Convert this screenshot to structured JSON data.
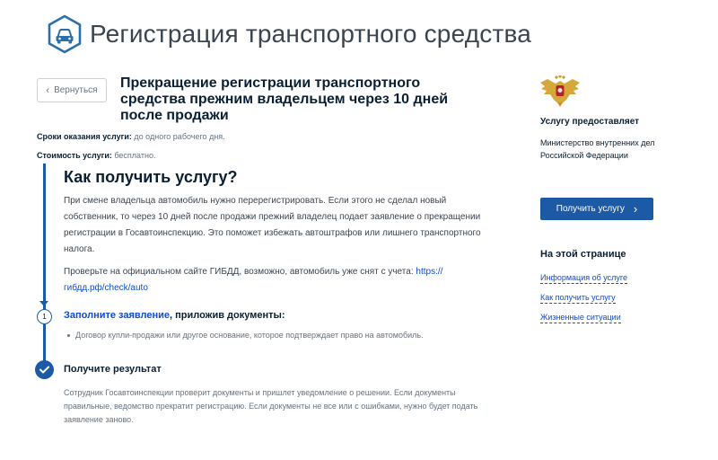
{
  "header": {
    "title": "Регистрация транспортного средства",
    "icon": "car-icon"
  },
  "back_button": {
    "label": "Вернуться",
    "icon": "chevron-left-icon"
  },
  "service": {
    "title": "Прекращение регистрации транспортного средства прежним владельцем через 10 дней после продажи"
  },
  "meta": {
    "term_label": "Сроки оказания услуги:",
    "term_value": "до одного рабочего дня.",
    "cost_label": "Стоимость услуги:",
    "cost_value": "бесплатно."
  },
  "how_to": {
    "heading": "Как получить услугу?",
    "intro": "При смене владельца автомобиль нужно перерегистрировать. Если этого не сделал новый собственник, то через 10 дней после продажи прежний владелец подает заявление о прекращении регистрации в Госавтоинспекцию. Это поможет избежать автоштрафов или лишнего транспортного налога.",
    "check_text": "Проверьте на официальном сайте ГИБДД, возможно, автомобиль уже снят с учета:",
    "check_link": "https:// гибдд.рф/check/auto"
  },
  "step1": {
    "number": "1",
    "link_text": "Заполните заявление",
    "rest_text": ", приложив документы:",
    "items": [
      "Договор купли-продажи или другое основание, которое подтверждает право на автомобиль."
    ]
  },
  "result": {
    "heading": "Получите результат",
    "text": "Сотрудник Госавтоинспекции проверит документы и пришлет уведомление о решении. Если документы правильные, ведомство прекратит регистрацию. Если документы не все или с ошибками, нужно будет подать заявление заново.",
    "icon": "check-icon"
  },
  "sidebar": {
    "provider_label": "Услугу предоставляет",
    "provider_name": "Министерство внутренних дел Российской Федерации",
    "emblem_icon": "eagle-emblem-icon",
    "get_button": "Получить услугу",
    "on_page_heading": "На этой странице",
    "on_page_links": [
      "Информация об услуге",
      "Как получить услугу",
      "Жизненные ситуации"
    ]
  },
  "colors": {
    "primary": "#1d5aa6",
    "link": "#0d4cd3",
    "text": "#0b1f33",
    "muted": "#66727f"
  }
}
